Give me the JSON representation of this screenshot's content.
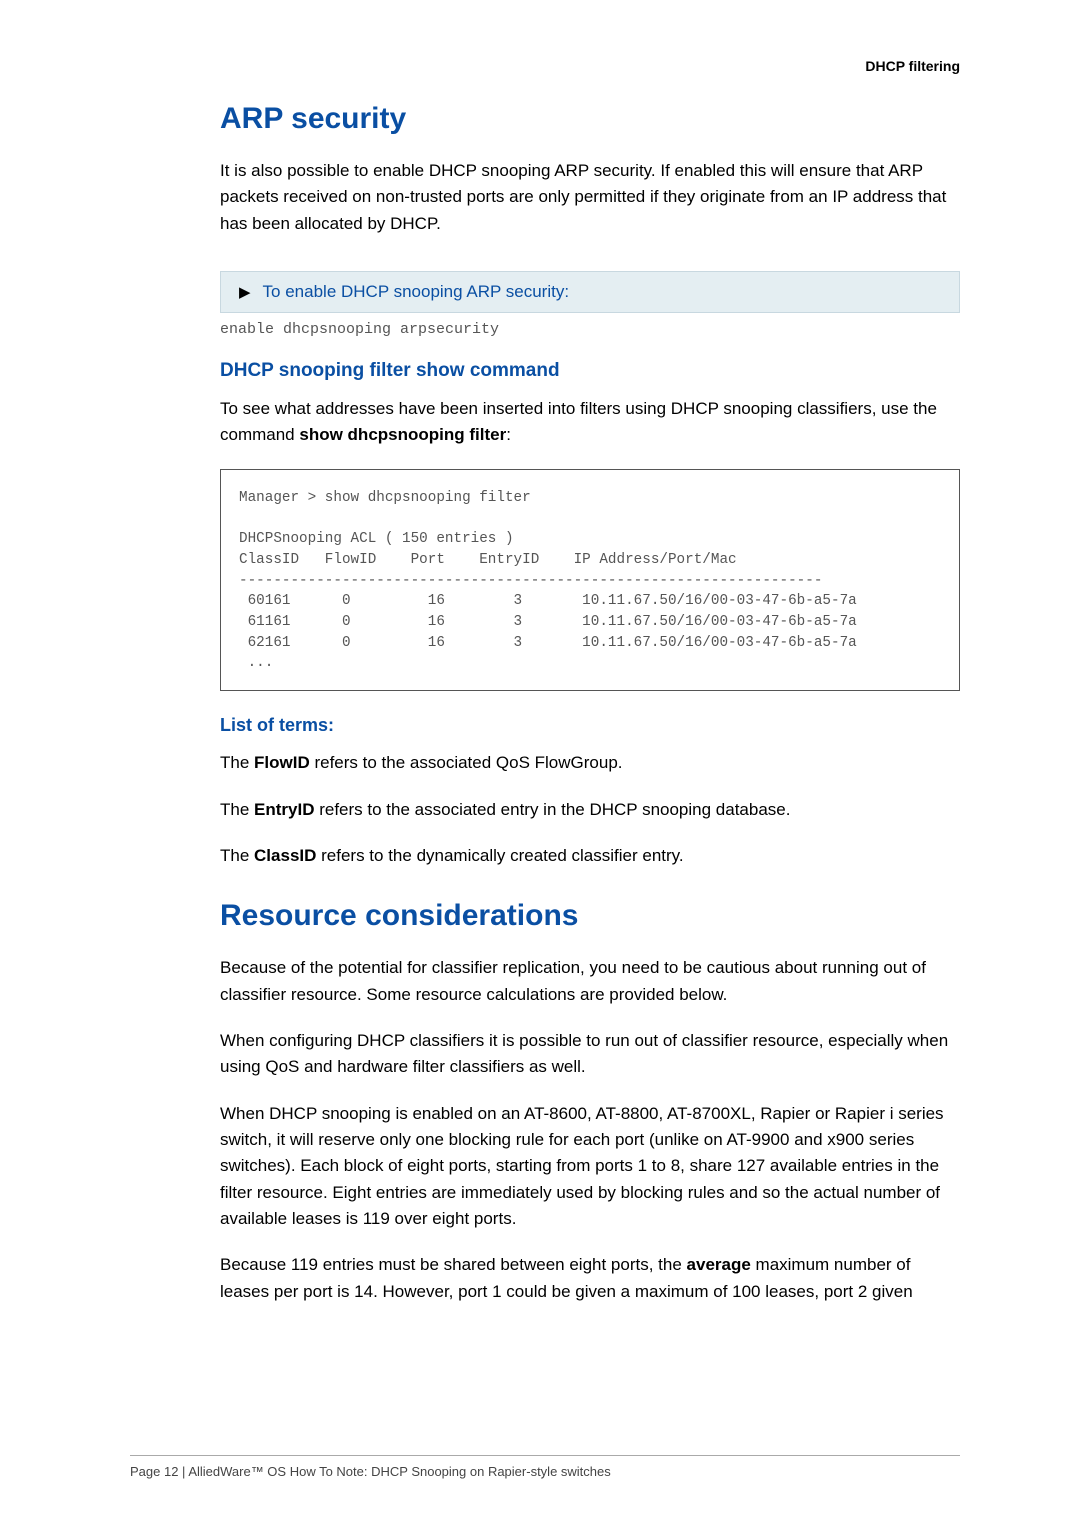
{
  "header": {
    "right": "DHCP filtering"
  },
  "h1_arp": "ARP security",
  "p_arp_intro": "It is also possible to enable DHCP snooping ARP security. If enabled this will ensure that ARP packets received on non-trusted ports are only permitted if they originate from an IP address that has been allocated by DHCP.",
  "callout_arp": "To enable DHCP snooping ARP security:",
  "code_enable": "enable dhcpsnooping arpsecurity",
  "h3_filtershow": "DHCP snooping filter show command",
  "p_filtershow_1a": "To see what addresses have been inserted into filters using DHCP snooping classifiers, use the command ",
  "p_filtershow_1b": "show dhcpsnooping filter",
  "p_filtershow_1c": ":",
  "codebox": "Manager > show dhcpsnooping filter\n\nDHCPSnooping ACL ( 150 entries )\nClassID   FlowID    Port    EntryID    IP Address/Port/Mac\n--------------------------------------------------------------------\n 60161      0         16        3       10.11.67.50/16/00-03-47-6b-a5-7a\n 61161      0         16        3       10.11.67.50/16/00-03-47-6b-a5-7a\n 62161      0         16        3       10.11.67.50/16/00-03-47-6b-a5-7a\n ...",
  "h4_terms": "List of terms:",
  "terms": {
    "t1a": "The ",
    "t1b": "FlowID",
    "t1c": " refers to the associated QoS FlowGroup.",
    "t2a": "The ",
    "t2b": "EntryID",
    "t2c": " refers to the associated entry in the DHCP snooping database.",
    "t3a": "The ",
    "t3b": "ClassID",
    "t3c": " refers to the dynamically created classifier entry."
  },
  "h1_resource": "Resource considerations",
  "p_res_1": "Because of the potential for classifier replication, you need to be cautious about running out of classifier resource. Some resource calculations are provided below.",
  "p_res_2": "When configuring DHCP classifiers it is possible to run out of classifier resource, especially when using QoS and hardware filter classifiers as well.",
  "p_res_3": "When DHCP snooping is enabled on an AT-8600, AT-8800, AT-8700XL, Rapier or Rapier i series switch, it will reserve only one blocking rule for each port (unlike on AT-9900 and x900 series switches). Each block of eight ports, starting from ports 1 to 8, share 127 available entries in the filter resource. Eight entries are immediately used by blocking rules and so the actual number of available leases is 119 over eight ports.",
  "p_res_4a": "Because 119 entries must be shared between eight ports, the ",
  "p_res_4b": "average",
  "p_res_4c": " maximum number of leases per port is 14. However, port 1 could be given a maximum of 100 leases, port 2 given",
  "footer": "Page 12 | AlliedWare™ OS How To Note: DHCP Snooping on Rapier-style switches"
}
